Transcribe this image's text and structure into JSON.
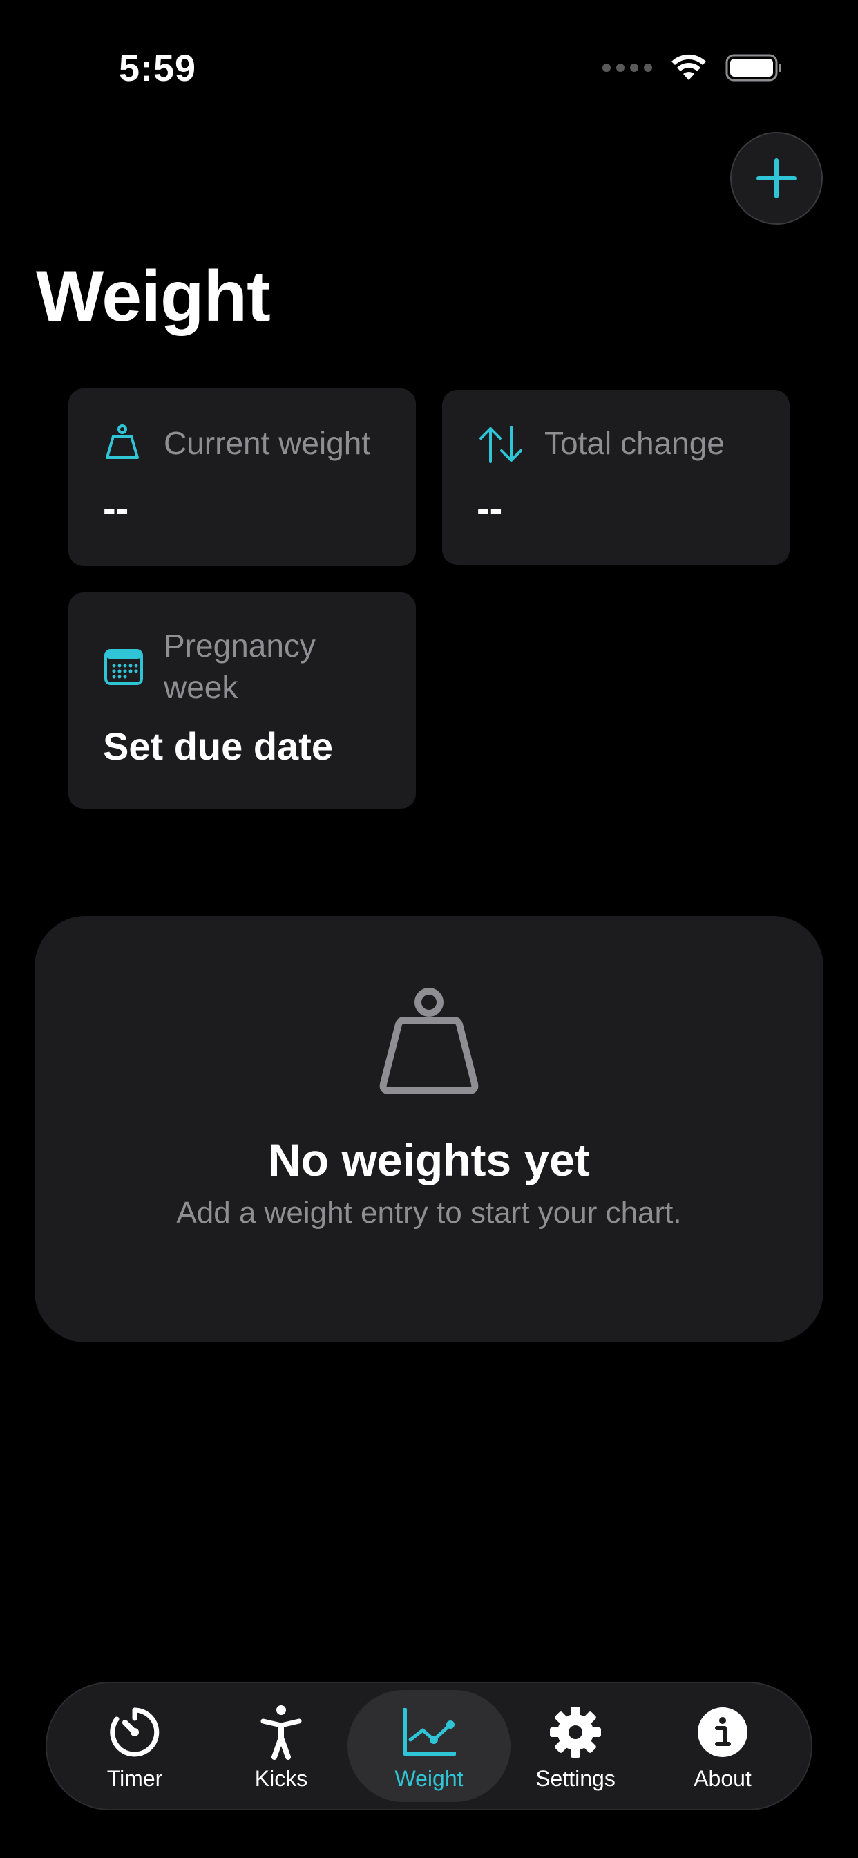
{
  "status_bar": {
    "time": "5:59"
  },
  "header": {
    "title": "Weight"
  },
  "accent_color": "#2fc4d6",
  "stats": {
    "current_weight": {
      "label": "Current weight",
      "value": "--",
      "icon": "scale-weight-icon"
    },
    "total_change": {
      "label": "Total change",
      "value": "--",
      "icon": "arrows-up-down-icon"
    },
    "pregnancy_week": {
      "label_line1": "Pregnancy",
      "label_line2": "week",
      "value": "Set due date",
      "icon": "calendar-icon"
    }
  },
  "empty_state": {
    "icon": "scale-weight-icon",
    "title": "No weights yet",
    "subtitle": "Add a weight entry to start your chart."
  },
  "tabs": [
    {
      "label": "Timer",
      "icon": "timer-icon",
      "active": false
    },
    {
      "label": "Kicks",
      "icon": "figure-icon",
      "active": false
    },
    {
      "label": "Weight",
      "icon": "chart-line-icon",
      "active": true
    },
    {
      "label": "Settings",
      "icon": "gear-icon",
      "active": false
    },
    {
      "label": "About",
      "icon": "info-icon",
      "active": false
    }
  ]
}
